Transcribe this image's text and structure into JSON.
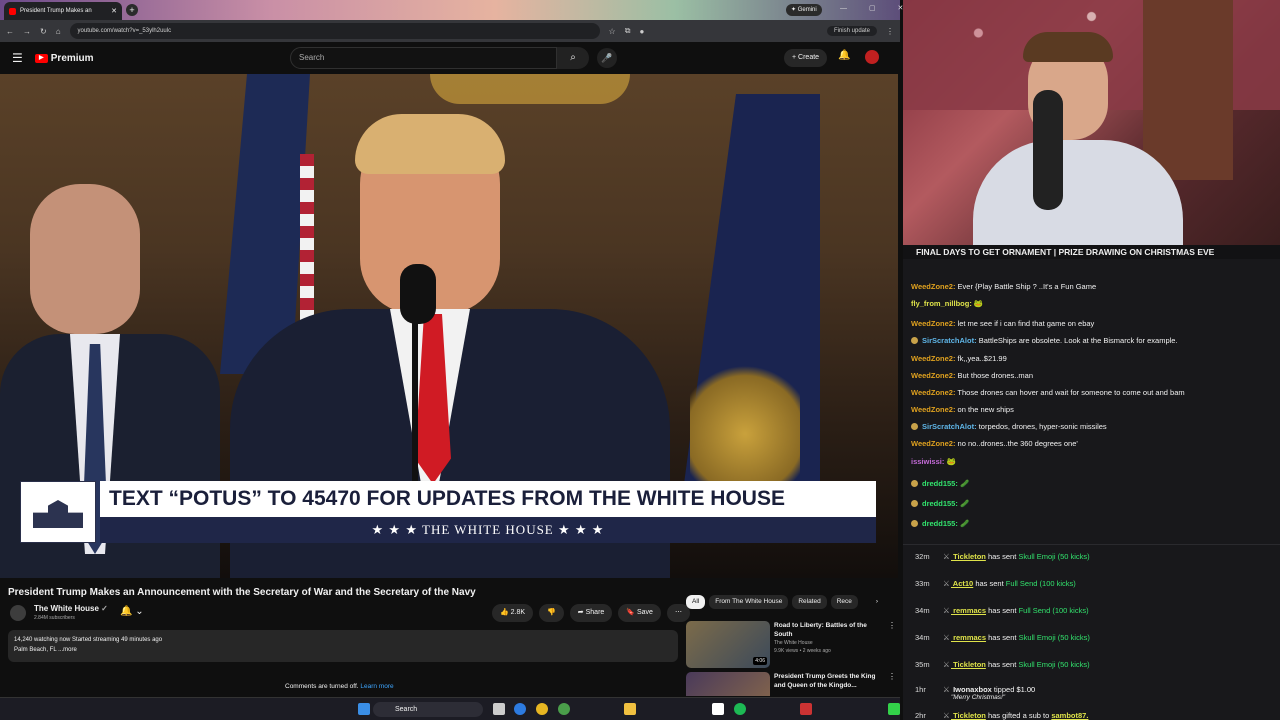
{
  "browser": {
    "tab_title": "President Trump Makes an",
    "new_tab": "+",
    "gemini_label": "✦ Gemini",
    "window_controls": "— ▢ ✕",
    "url": "youtube.com/watch?v=_53ylh2uulc",
    "finish_update": "Finish update"
  },
  "youtube": {
    "logo": "Premium",
    "search_placeholder": "Search",
    "create_label": "Create"
  },
  "video": {
    "lower_third_headline": "TEXT “POTUS” TO 45470 FOR UPDATES FROM THE WHITE HOUSE",
    "lower_third_sub": "★ ★ ★   THE WHITE HOUSE   ★ ★ ★",
    "title": "President Trump Makes an Announcement with the Secretary of War and the Secretary of the Navy",
    "channel": "The White House",
    "subscribers": "2.84M subscribers",
    "likes": "2.8K",
    "share": "Share",
    "save": "Save",
    "description_line1": "14,240 watching now  Started streaming 49 minutes ago",
    "description_line2": "Palm Beach, FL ...more",
    "comments_off": "Comments are turned off.",
    "learn_more": "Learn more"
  },
  "recs": {
    "chips": [
      "All",
      "From The White House",
      "Related",
      "Rece"
    ],
    "items": [
      {
        "title": "Road to Liberty: Battles of the South",
        "channel": "The White House",
        "meta": "9.9K views • 2 weeks ago",
        "duration": "4:06"
      },
      {
        "title": "President Trump Greets the King and Queen of the Kingdo...",
        "channel": "",
        "meta": "",
        "duration": ""
      }
    ]
  },
  "taskbar": {
    "search": "Search"
  },
  "stream": {
    "banner": "FINAL DAYS TO GET ORNAMENT | PRIZE DRAWING ON CHRISTMAS EVE",
    "chat": [
      {
        "user": "WeedZone2:",
        "text": "Ever {Play Battle Ship ? ..It's a Fun Game",
        "color": "#dfa11f"
      },
      {
        "user": "fly_from_nillbog:",
        "text": "🐸",
        "color": "#dfe34a"
      },
      {
        "user": "WeedZone2:",
        "text": "let me see if i can find that game on ebay",
        "color": "#dfa11f"
      },
      {
        "user": "SirScratchAlot:",
        "text": "BattleShips are obsolete. Look at the Bismarck for example.",
        "color": "#5fb6e8"
      },
      {
        "user": "WeedZone2:",
        "text": "fk,,yea..$21.99",
        "color": "#dfa11f"
      },
      {
        "user": "WeedZone2:",
        "text": "But those drones..man",
        "color": "#dfa11f"
      },
      {
        "user": "WeedZone2:",
        "text": "Those drones can hover and wait for someone to come out and bam",
        "color": "#dfa11f"
      },
      {
        "user": "WeedZone2:",
        "text": "on the new ships",
        "color": "#dfa11f"
      },
      {
        "user": "SirScratchAlot:",
        "text": "torpedos, drones, hyper-sonic missiles",
        "color": "#5fb6e8"
      },
      {
        "user": "WeedZone2:",
        "text": "no no..drones..the 360 degrees one'",
        "color": "#dfa11f"
      },
      {
        "user": "issiwissi:",
        "text": "🐸",
        "color": "#c46bd8"
      },
      {
        "user": "dredd155:",
        "text": "🥒",
        "color": "#32e36d"
      },
      {
        "user": "dredd155:",
        "text": "🥒",
        "color": "#32e36d"
      },
      {
        "user": "dredd155:",
        "text": "🥒",
        "color": "#32e36d"
      }
    ],
    "events": [
      {
        "time": "32m",
        "user": "Tickleton",
        "verb": "has sent",
        "item": "Skull Emoji (50 kicks)"
      },
      {
        "time": "33m",
        "user": "Act10",
        "verb": "has sent",
        "item": "Full Send (100 kicks)"
      },
      {
        "time": "34m",
        "user": "remmacs",
        "verb": "has sent",
        "item": "Full Send (100 kicks)"
      },
      {
        "time": "34m",
        "user": "remmacs",
        "verb": "has sent",
        "item": "Skull Emoji (50 kicks)"
      },
      {
        "time": "35m",
        "user": "Tickleton",
        "verb": "has sent",
        "item": "Skull Emoji (50 kicks)"
      },
      {
        "time": "1hr",
        "user": "Iwonaxbox",
        "verb": "tipped",
        "item": "$1.00",
        "note": "\"Merry Christmas!\""
      },
      {
        "time": "2hr",
        "user": "Tickleton",
        "verb": "has gifted a sub to",
        "item": "sambot87."
      }
    ]
  }
}
